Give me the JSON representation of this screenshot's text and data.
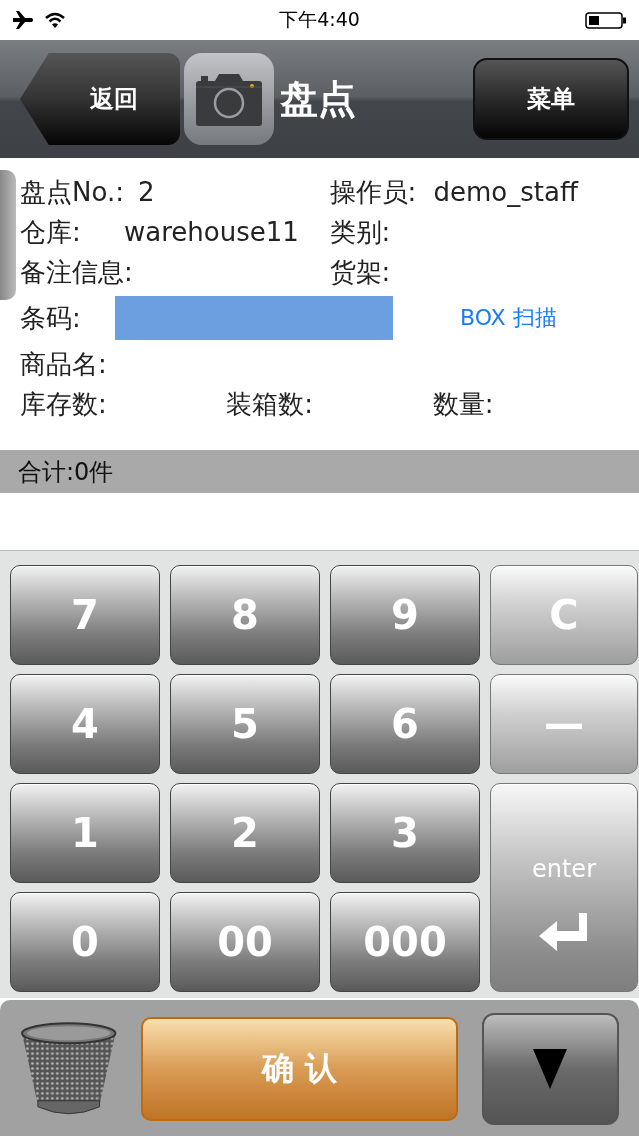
{
  "status_bar": {
    "time": "下午4:40"
  },
  "nav": {
    "back": "返回",
    "title": "盘点",
    "menu": "菜单"
  },
  "form": {
    "rows": [
      [
        {
          "kind": "pair",
          "label": "盘点No.:",
          "value": "2"
        },
        {
          "kind": "pair",
          "label": "操作员:",
          "value": "demo_staff"
        }
      ],
      [
        {
          "kind": "pair",
          "label": "仓库:",
          "value": "warehouse11"
        },
        {
          "kind": "pair",
          "label": "类别:"
        }
      ],
      [
        {
          "kind": "pair",
          "label": "备注信息:"
        },
        {
          "kind": "pair",
          "label": "货架:"
        }
      ],
      [
        {
          "kind": "input",
          "label": "条码:"
        },
        {
          "kind": "link",
          "text": "BOX 扫描"
        }
      ],
      [
        {
          "kind": "pair",
          "label": "商品名:"
        }
      ],
      [
        {
          "kind": "pair",
          "label": "库存数:"
        },
        {
          "kind": "pair",
          "label": "装箱数:"
        },
        {
          "kind": "pair",
          "label": "数量:"
        }
      ]
    ]
  },
  "total": "合计:0件",
  "keypad": [
    {
      "kind": "digit",
      "label": "7"
    },
    {
      "kind": "digit",
      "label": "8"
    },
    {
      "kind": "digit",
      "label": "9"
    },
    {
      "kind": "function",
      "label": "C"
    },
    {
      "kind": "digit",
      "label": "4"
    },
    {
      "kind": "digit",
      "label": "5"
    },
    {
      "kind": "digit",
      "label": "6"
    },
    {
      "kind": "function",
      "label": "—"
    },
    {
      "kind": "digit",
      "label": "1"
    },
    {
      "kind": "digit",
      "label": "2"
    },
    {
      "kind": "digit",
      "label": "3"
    },
    {
      "kind": "enter",
      "label": "enter"
    },
    {
      "kind": "digit",
      "label": "0"
    },
    {
      "kind": "digit",
      "label": "00"
    },
    {
      "kind": "digit",
      "label": "000"
    }
  ],
  "bottom": {
    "confirm": "确 认"
  }
}
